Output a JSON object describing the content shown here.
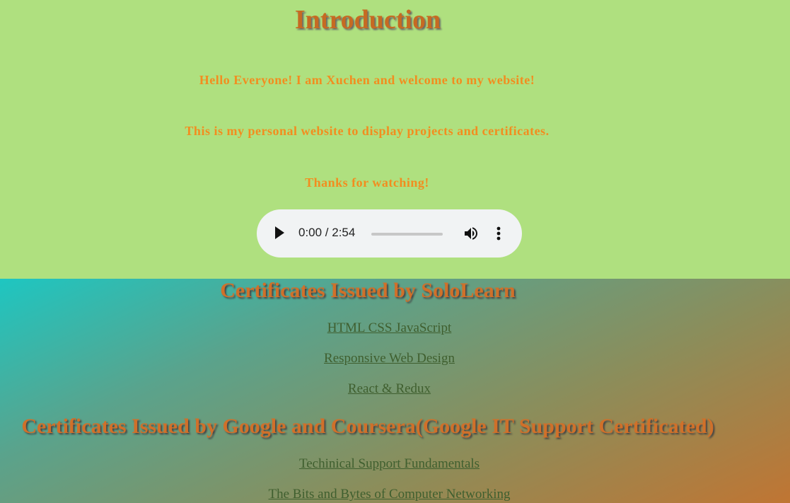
{
  "intro": {
    "title": "Introduction",
    "lines": [
      "Hello Everyone! I am Xuchen and welcome to my website!",
      "This is my personal website to display projects and certificates.",
      "Thanks for watching!"
    ],
    "audio": {
      "time": "0:00 / 2:54",
      "progress": 0
    }
  },
  "sololearn": {
    "heading": "Certificates Issued by SoloLearn",
    "links": [
      "HTML CSS JavaScript",
      "Responsive Web Design",
      "React & Redux"
    ]
  },
  "google": {
    "heading": "Certificates Issued by Google and Coursera(Google IT Support Certificated)",
    "links": [
      "Techinical Support Fundamentals",
      "The Bits and Bytes of Computer Networking"
    ]
  }
}
